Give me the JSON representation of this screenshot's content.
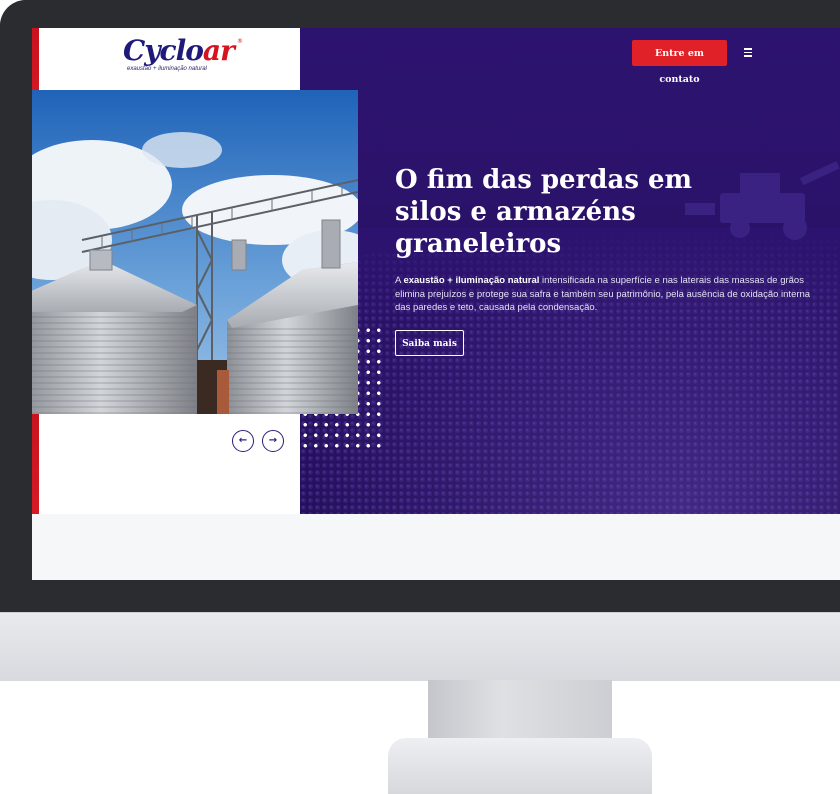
{
  "brand": {
    "logo_part1": "Cyclo",
    "logo_part2": "ar",
    "registered": "®",
    "tagline": "exaustão + iluminação natural"
  },
  "header": {
    "contact_button": "Entre em contato",
    "menu_icon": "hamburger-menu-icon"
  },
  "hero": {
    "headline": "O fim das perdas em silos e armazéns graneleiros",
    "description_prefix": "A ",
    "description_bold": "exaustão + iluminação natural",
    "description_rest": " intensificada na superfície e nas laterais das massas de grãos elimina prejuízos e protege sua safra e também seu patrimônio, pela ausência de oxidação interna das paredes e teto, causada pela condensação.",
    "cta_label": "Saiba mais"
  },
  "slider": {
    "prev_icon": "arrow-left-icon",
    "next_icon": "arrow-right-icon",
    "prev_glyph": "←",
    "next_glyph": "→"
  },
  "colors": {
    "brand_blue": "#1f1a7a",
    "brand_red": "#d6141f",
    "hero_purple": "#2d1370",
    "button_red": "#e12128"
  }
}
